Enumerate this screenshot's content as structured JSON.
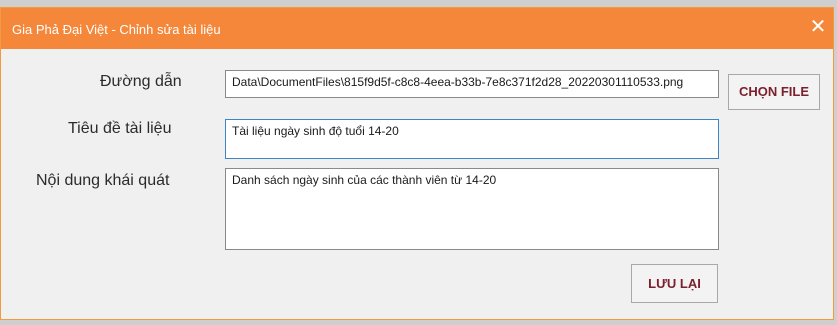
{
  "window": {
    "title": "Gia Phả Đại Việt - Chỉnh sửa tài liệu",
    "close_glyph": "✕"
  },
  "form": {
    "path_label": "Đường dẫn",
    "path_value": "Data\\DocumentFiles\\815f9d5f-c8c8-4eea-b33b-7e8c371f2d28_20220301110533.png",
    "title_label": "Tiêu đề  tài liệu",
    "title_value": "Tài liệu ngày sinh độ tuổi 14-20",
    "summary_label": "Nội dung khái quát",
    "summary_value": "Danh sách ngày sinh của các thành viên từ 14-20"
  },
  "buttons": {
    "choose_file": "CHỌN FILE",
    "save": "LƯU LẠI"
  },
  "colors": {
    "titlebar": "#f4873a",
    "button_text": "#7a1f2b",
    "focus_border": "#3f84c8"
  }
}
